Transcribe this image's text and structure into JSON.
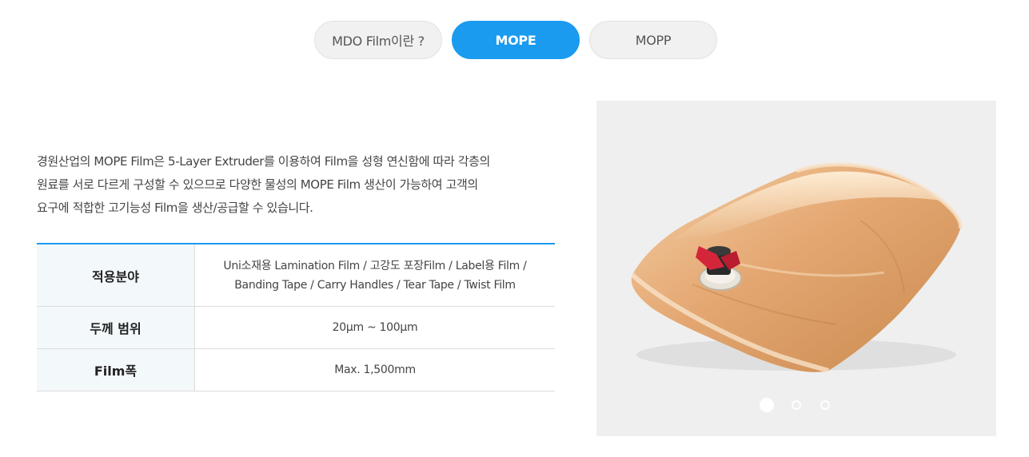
{
  "tabs": [
    {
      "label": "MDO Film이란 ?",
      "active": false
    },
    {
      "label": "MOPE",
      "active": true
    },
    {
      "label": "MOPP",
      "active": false
    }
  ],
  "description": {
    "line1": "경원산업의 MOPE Film은 5-Layer Extruder를 이용하여 Film을 성형 연신함에 따라 각층의",
    "line2": "원료를 서로 다르게 구성할 수 있으므로 다양한 물성의 MOPE Film 생산이 가능하여 고객의",
    "line3": "요구에 적합한 고기능성 Film을 생산/공급할 수 있습니다."
  },
  "spec_table": {
    "rows": [
      {
        "header": "적용분야",
        "value_line1": "Uni소재용 Lamination Film / 고강도 포장Film / Label용 Film /",
        "value_line2": "Banding Tape / Carry Handles / Tear Tape / Twist Film"
      },
      {
        "header": "두께 범위",
        "value": "20μm ~ 100μm"
      },
      {
        "header": "Film폭",
        "value": "Max. 1,500mm"
      }
    ]
  },
  "carousel": {
    "image_alt": "MOPE bag-in-box pouch with spout",
    "slides_count": 3,
    "active_index": 0
  },
  "colors": {
    "accent": "#1a9bf0",
    "tab_inactive_bg": "#f1f1f1",
    "table_header_bg": "#f3f8fb"
  }
}
